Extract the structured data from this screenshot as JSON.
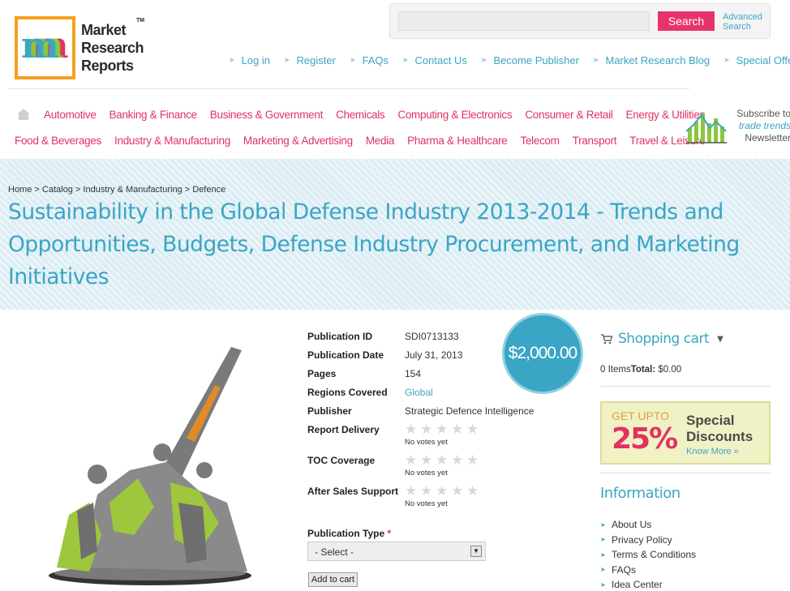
{
  "logo": {
    "mark": "m",
    "line1": "Market",
    "line2": "Research",
    "line3": "Reports",
    "tm": "TM"
  },
  "search": {
    "placeholder": "",
    "button": "Search",
    "advanced_line1": "Advanced",
    "advanced_line2": "Search"
  },
  "toplinks": [
    "Log in",
    "Register",
    "FAQs",
    "Contact Us",
    "Become Publisher",
    "Market Research Blog",
    "Special Offers"
  ],
  "nav": {
    "row1": [
      "Automotive",
      "Banking & Finance",
      "Business & Government",
      "Chemicals",
      "Computing & Electronics",
      "Consumer & Retail",
      "Energy & Utilities"
    ],
    "row2": [
      "Food & Beverages",
      "Industry & Manufacturing",
      "Marketing & Advertising",
      "Media",
      "Pharma & Healthcare",
      "Telecom",
      "Transport",
      "Travel & Leisure"
    ]
  },
  "newsletter": {
    "line1": "Subscribe to",
    "line2": "trade trends",
    "line3": "Newsletter"
  },
  "breadcrumb": {
    "home": "Home",
    "catalog": "Catalog",
    "category": "Industry & Manufacturing",
    "current": "Defence",
    "sep": ">"
  },
  "title": "Sustainability in the Global Defense Industry 2013-2014 - Trends and Opportunities, Budgets, Defense Industry Procurement, and Marketing Initiatives",
  "details": {
    "pub_id_label": "Publication ID",
    "pub_id": "SDI0713133",
    "pub_date_label": "Publication Date",
    "pub_date": "July 31, 2013",
    "pages_label": "Pages",
    "pages": "154",
    "regions_label": "Regions Covered",
    "regions": "Global",
    "publisher_label": "Publisher",
    "publisher": "Strategic Defence Intelligence",
    "delivery_label": "Report Delivery",
    "toc_label": "TOC Coverage",
    "aftersales_label": "After Sales Support",
    "no_votes": "No votes yet",
    "rating_delivery": 0,
    "rating_toc": 0,
    "rating_aftersales": 0
  },
  "price": "$2,000.00",
  "pubtype": {
    "label": "Publication Type",
    "required": "*",
    "selected": "- Select -",
    "add_to_cart": "Add to cart"
  },
  "cart": {
    "title": "Shopping cart",
    "items": "0 Items",
    "total_label": "Total:",
    "total": "$0.00"
  },
  "discount": {
    "get_upto": "GET UPTO",
    "percent": "25%",
    "special": "Special",
    "discounts": "Discounts",
    "know_more": "Know More »"
  },
  "information": {
    "title": "Information",
    "items": [
      "About Us",
      "Privacy Policy",
      "Terms & Conditions",
      "FAQs",
      "Idea Center"
    ]
  },
  "colors": {
    "accent": "#3aa5c4",
    "pink": "#e13360",
    "logo_orange": "#f4a11d",
    "band": "#dcedf3"
  }
}
